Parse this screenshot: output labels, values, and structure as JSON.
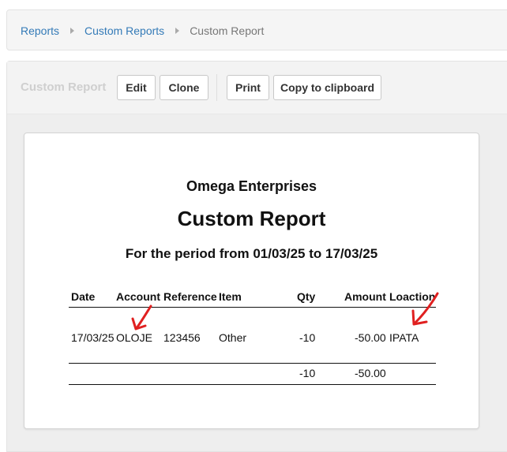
{
  "breadcrumb": {
    "items": [
      "Reports",
      "Custom Reports"
    ],
    "current": "Custom Report"
  },
  "toolbar": {
    "title": "Custom Report",
    "buttons": [
      "Edit",
      "Clone",
      "Print",
      "Copy to clipboard"
    ]
  },
  "report": {
    "company": "Omega Enterprises",
    "title": "Custom Report",
    "period": "For the period from 01/03/25 to 17/03/25",
    "columns": [
      "Date",
      "Account",
      "Reference",
      "Item",
      "Qty",
      "Amount",
      "Loaction"
    ],
    "rows": [
      [
        "17/03/25",
        "OLOJE",
        "123456",
        "Other",
        "-10",
        "-50.00",
        "IPATA"
      ]
    ],
    "totals": {
      "qty": "-10",
      "amount": "-50.00"
    }
  },
  "colors": {
    "link": "#337ab7",
    "annotation": "#e02020"
  }
}
